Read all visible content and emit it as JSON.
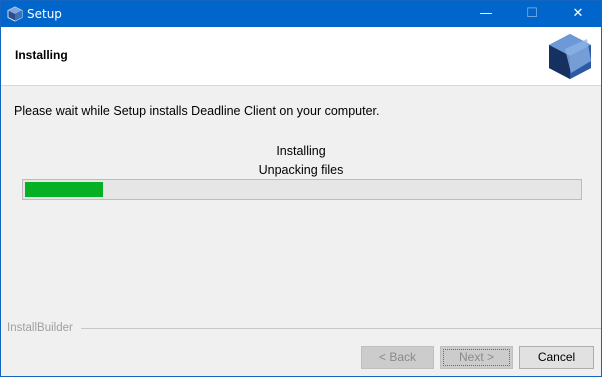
{
  "window": {
    "title": "Setup",
    "controls": {
      "minimize": "—",
      "maximize": "☐",
      "close": "✕"
    }
  },
  "header": {
    "title": "Installing",
    "logo_icon": "cube-logo-icon"
  },
  "main": {
    "message": "Please wait while Setup installs Deadline Client on your computer.",
    "status_line1": "Installing",
    "status_line2": "Unpacking files",
    "progress_fraction": 0.14
  },
  "footer": {
    "brand": "InstallBuilder",
    "back_label": "< Back",
    "next_label": "Next >",
    "cancel_label": "Cancel"
  },
  "colors": {
    "titlebar": "#0066cc",
    "progress_fill": "#06b025"
  }
}
